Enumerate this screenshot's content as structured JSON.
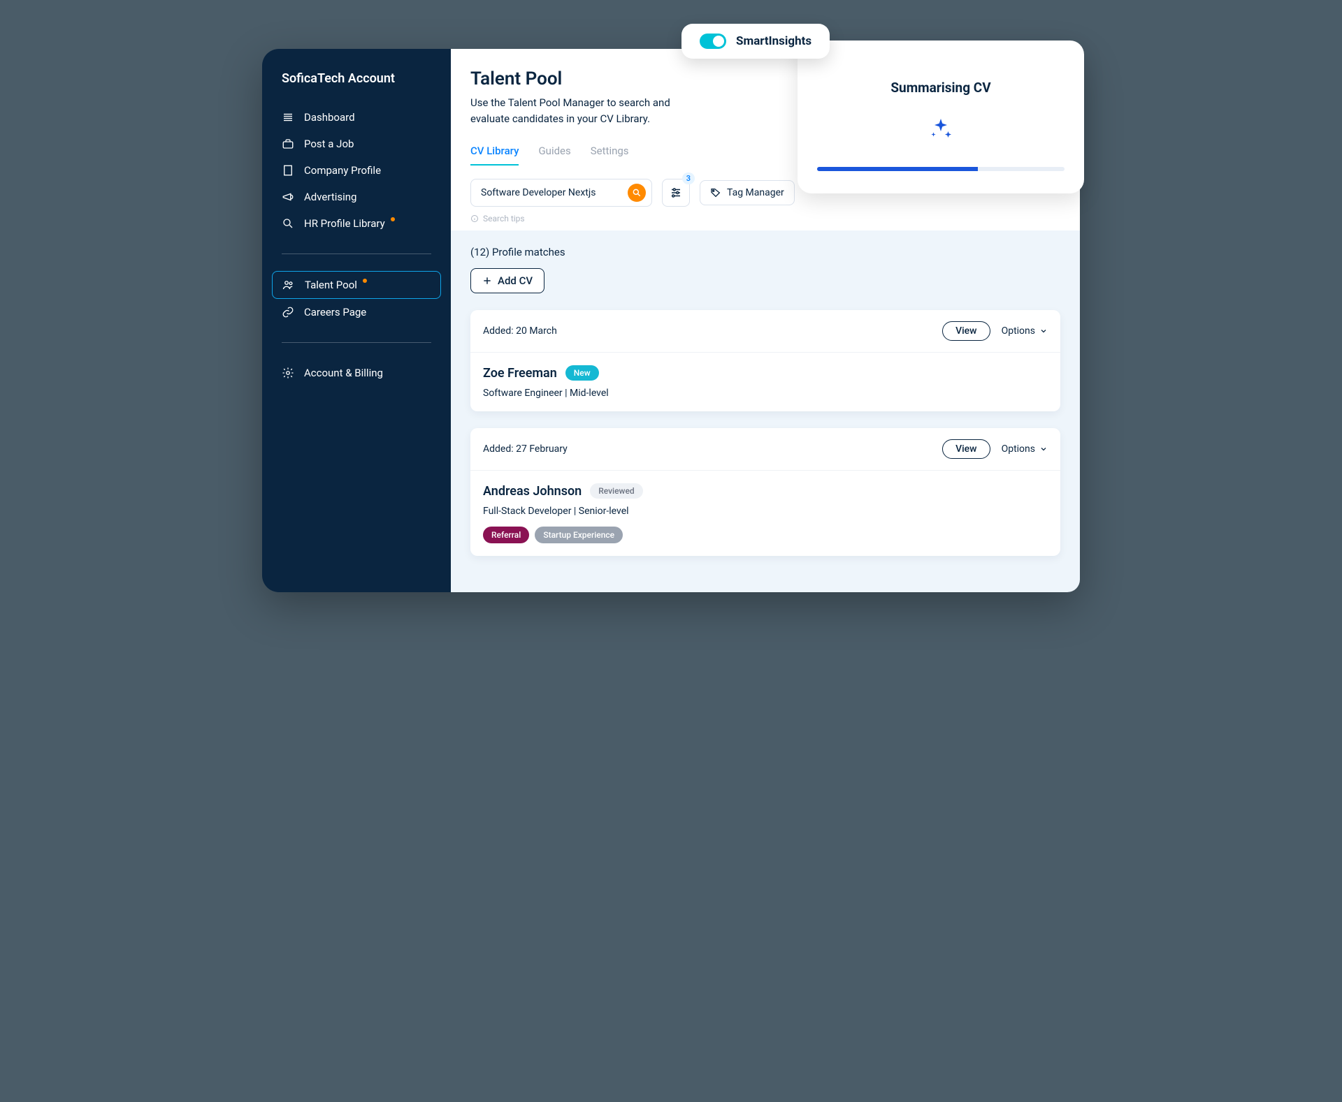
{
  "sidebar": {
    "account_title": "SoficaTech Account",
    "items": [
      {
        "label": "Dashboard",
        "icon": "dashboard"
      },
      {
        "label": "Post a Job",
        "icon": "briefcase"
      },
      {
        "label": "Company Profile",
        "icon": "building"
      },
      {
        "label": "Advertising",
        "icon": "megaphone"
      },
      {
        "label": "HR Profile Library",
        "icon": "search",
        "notif": true
      }
    ],
    "items2": [
      {
        "label": "Talent Pool",
        "icon": "users",
        "active": true,
        "notif": true
      },
      {
        "label": "Careers Page",
        "icon": "link"
      }
    ],
    "items3": [
      {
        "label": "Account & Billing",
        "icon": "gear"
      }
    ]
  },
  "page": {
    "title": "Talent Pool",
    "subtitle": "Use the Talent Pool Manager to search and evaluate candidates in your CV Library."
  },
  "tabs": [
    {
      "label": "CV Library",
      "active": true
    },
    {
      "label": "Guides"
    },
    {
      "label": "Settings"
    }
  ],
  "search": {
    "query": "Software Developer Nextjs",
    "filter_count": "3",
    "tag_manager_label": "Tag Manager",
    "tips_label": "Search tips"
  },
  "results": {
    "matches_label": "(12) Profile matches",
    "add_cv_label": "Add CV",
    "view_label": "View",
    "options_label": "Options",
    "candidates": [
      {
        "added": "Added: 20 March",
        "name": "Zoe Freeman",
        "status": "New",
        "status_class": "new",
        "role": "Software Engineer | Mid-level",
        "tags": []
      },
      {
        "added": "Added: 27 February",
        "name": "Andreas Johnson",
        "status": "Reviewed",
        "status_class": "reviewed",
        "role": "Full-Stack Developer | Senior-level",
        "tags": [
          {
            "label": "Referral",
            "class": "referral"
          },
          {
            "label": "Startup Experience",
            "class": "startup"
          }
        ]
      }
    ]
  },
  "smart_insights": {
    "toggle_label": "SmartInsights",
    "panel_title": "Summarising CV",
    "progress_pct": 65
  }
}
